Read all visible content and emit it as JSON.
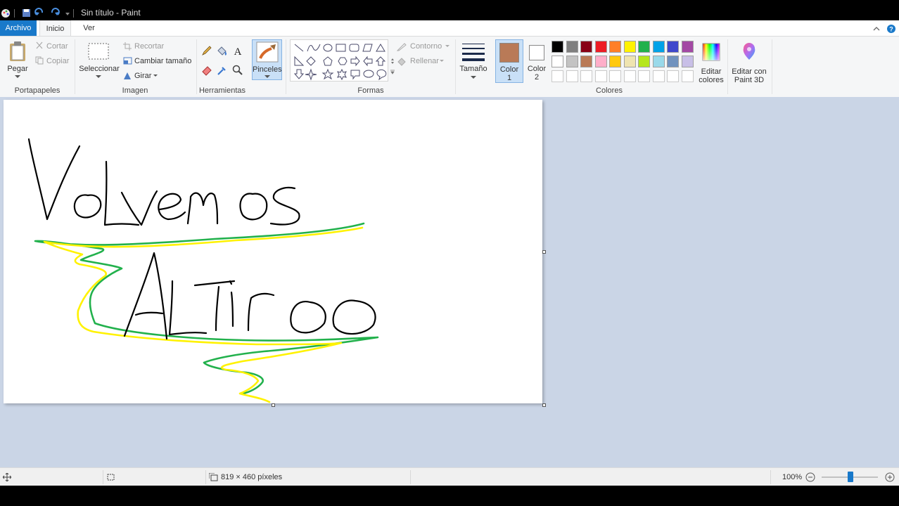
{
  "app": {
    "title": "Sin título - Paint"
  },
  "tabs": [
    {
      "label": "Archivo"
    },
    {
      "label": "Inicio"
    },
    {
      "label": "Ver"
    }
  ],
  "ribbon": {
    "clipboard": {
      "paste": "Pegar",
      "cut": "Cortar",
      "copy": "Copiar",
      "group": "Portapapeles"
    },
    "image": {
      "select": "Seleccionar",
      "crop": "Recortar",
      "resize": "Cambiar tamaño",
      "rotate": "Girar",
      "group": "Imagen"
    },
    "tools": {
      "group": "Herramientas"
    },
    "brushes": {
      "label": "Pinceles"
    },
    "shapes": {
      "outline": "Contorno",
      "fill": "Rellenar",
      "group": "Formas"
    },
    "size": {
      "label": "Tamaño"
    },
    "color1": {
      "label": "Color",
      "number": "1",
      "value": "#b97a57"
    },
    "color2": {
      "label": "Color",
      "number": "2",
      "value": "#ffffff"
    },
    "colors": {
      "group": "Colores",
      "row1": [
        "#000000",
        "#7f7f7f",
        "#880015",
        "#ed1c24",
        "#ff7f27",
        "#fff200",
        "#22b14c",
        "#00a2e8",
        "#3f48cc",
        "#a349a4"
      ],
      "row2": [
        "#ffffff",
        "#c3c3c3",
        "#b97a57",
        "#ffaec9",
        "#ffc90e",
        "#efe4b0",
        "#b5e61d",
        "#99d9ea",
        "#7092be",
        "#c8bfe7"
      ]
    },
    "edit_colors": {
      "line1": "Editar",
      "line2": "colores"
    },
    "paint3d": {
      "line1": "Editar con",
      "line2": "Paint 3D"
    }
  },
  "status": {
    "dimensions": "819 × 460 píxeles",
    "zoom": "100%"
  }
}
